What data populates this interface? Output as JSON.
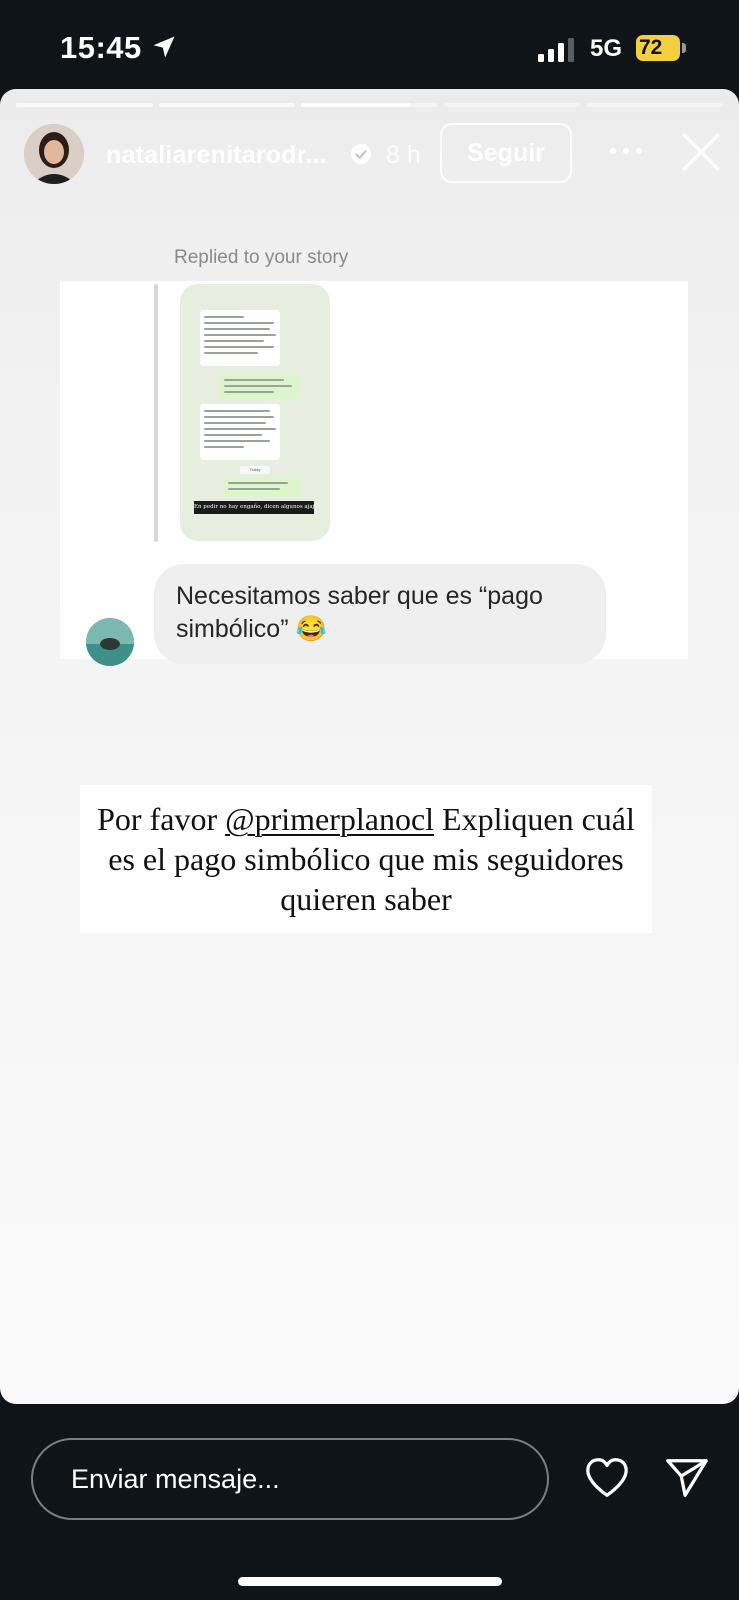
{
  "status_bar": {
    "time": "15:45",
    "network": "5G",
    "battery": "72"
  },
  "story": {
    "progress": {
      "segments": 5,
      "completed": 2,
      "current_fraction": 0.8
    },
    "header": {
      "username": "nataliarenitarodr...",
      "time_ago": "8 h",
      "follow_label": "Seguir"
    },
    "replied_label": "Replied to your story",
    "thumbnail_caption": "En pedir no hay engaño, dicen algunos ajajajaja",
    "thumbnail_today": "Today",
    "reply_message": "Necesitamos saber que es “pago simbólico” 😂",
    "caption": {
      "before": "Por favor ",
      "mention": "@primerplanocl",
      "after": "  Expliquen cuál es el pago simbólico que mis seguidores quieren saber"
    }
  },
  "bottom_bar": {
    "message_placeholder": "Enviar mensaje..."
  },
  "icons": {
    "location": "location-arrow-icon",
    "verified": "verified-badge-icon",
    "more": "more-dots-icon",
    "close": "close-icon",
    "heart": "heart-icon",
    "send": "send-icon"
  }
}
